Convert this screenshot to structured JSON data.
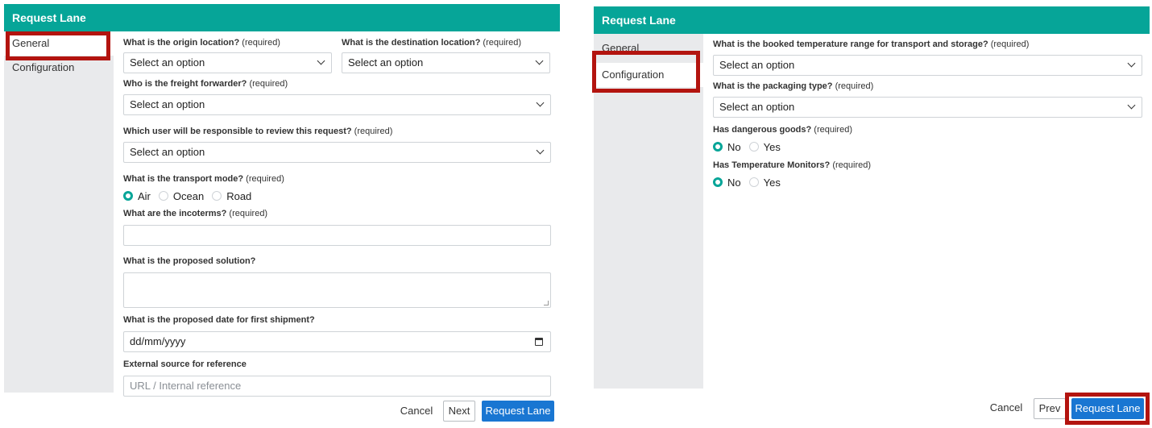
{
  "left": {
    "title": "Request Lane",
    "sidebar": [
      {
        "label": "General"
      },
      {
        "label": "Configuration"
      }
    ],
    "fields": {
      "origin": {
        "label": "What is the origin location?",
        "req": " (required)",
        "value": "Select an option"
      },
      "destination": {
        "label": "What is the destination location?",
        "req": " (required)",
        "value": "Select an option"
      },
      "forwarder": {
        "label": "Who is the freight forwarder?",
        "req": " (required)",
        "value": "Select an option"
      },
      "reviewer": {
        "label": "Which user will be responsible to review this request?",
        "req": " (required)",
        "value": "Select an option"
      },
      "transport": {
        "label": "What is the transport mode?",
        "req": " (required)",
        "options": [
          "Air",
          "Ocean",
          "Road"
        ],
        "selected": "Air"
      },
      "incoterms": {
        "label": "What are the incoterms?",
        "req": " (required)",
        "value": ""
      },
      "solution": {
        "label": "What is the proposed solution?",
        "value": ""
      },
      "date": {
        "label": "What is the proposed date for first shipment?",
        "value": "dd/mm/yyyy"
      },
      "external": {
        "label": "External source for reference",
        "placeholder": "URL / Internal reference"
      }
    },
    "footer": {
      "cancel": "Cancel",
      "next": "Next",
      "submit": "Request Lane"
    }
  },
  "right": {
    "title": "Request Lane",
    "sidebar": [
      {
        "label": "General"
      },
      {
        "label": "Configuration"
      }
    ],
    "fields": {
      "temperature": {
        "label": "What is the booked temperature range for transport and storage?",
        "req": " (required)",
        "value": "Select an option"
      },
      "packaging": {
        "label": "What is the packaging type?",
        "req": " (required)",
        "value": "Select an option"
      },
      "dangerous": {
        "label": "Has dangerous goods?",
        "req": " (required)",
        "options": [
          "No",
          "Yes"
        ],
        "selected": "No"
      },
      "monitors": {
        "label": "Has Temperature Monitors?",
        "req": " (required)",
        "options": [
          "No",
          "Yes"
        ],
        "selected": "No"
      }
    },
    "footer": {
      "cancel": "Cancel",
      "prev": "Prev",
      "submit": "Request Lane"
    }
  },
  "colors": {
    "header": "#06a598",
    "primary": "#1976d2",
    "highlight": "#b3140f",
    "sidebar": "#e9eaec"
  }
}
